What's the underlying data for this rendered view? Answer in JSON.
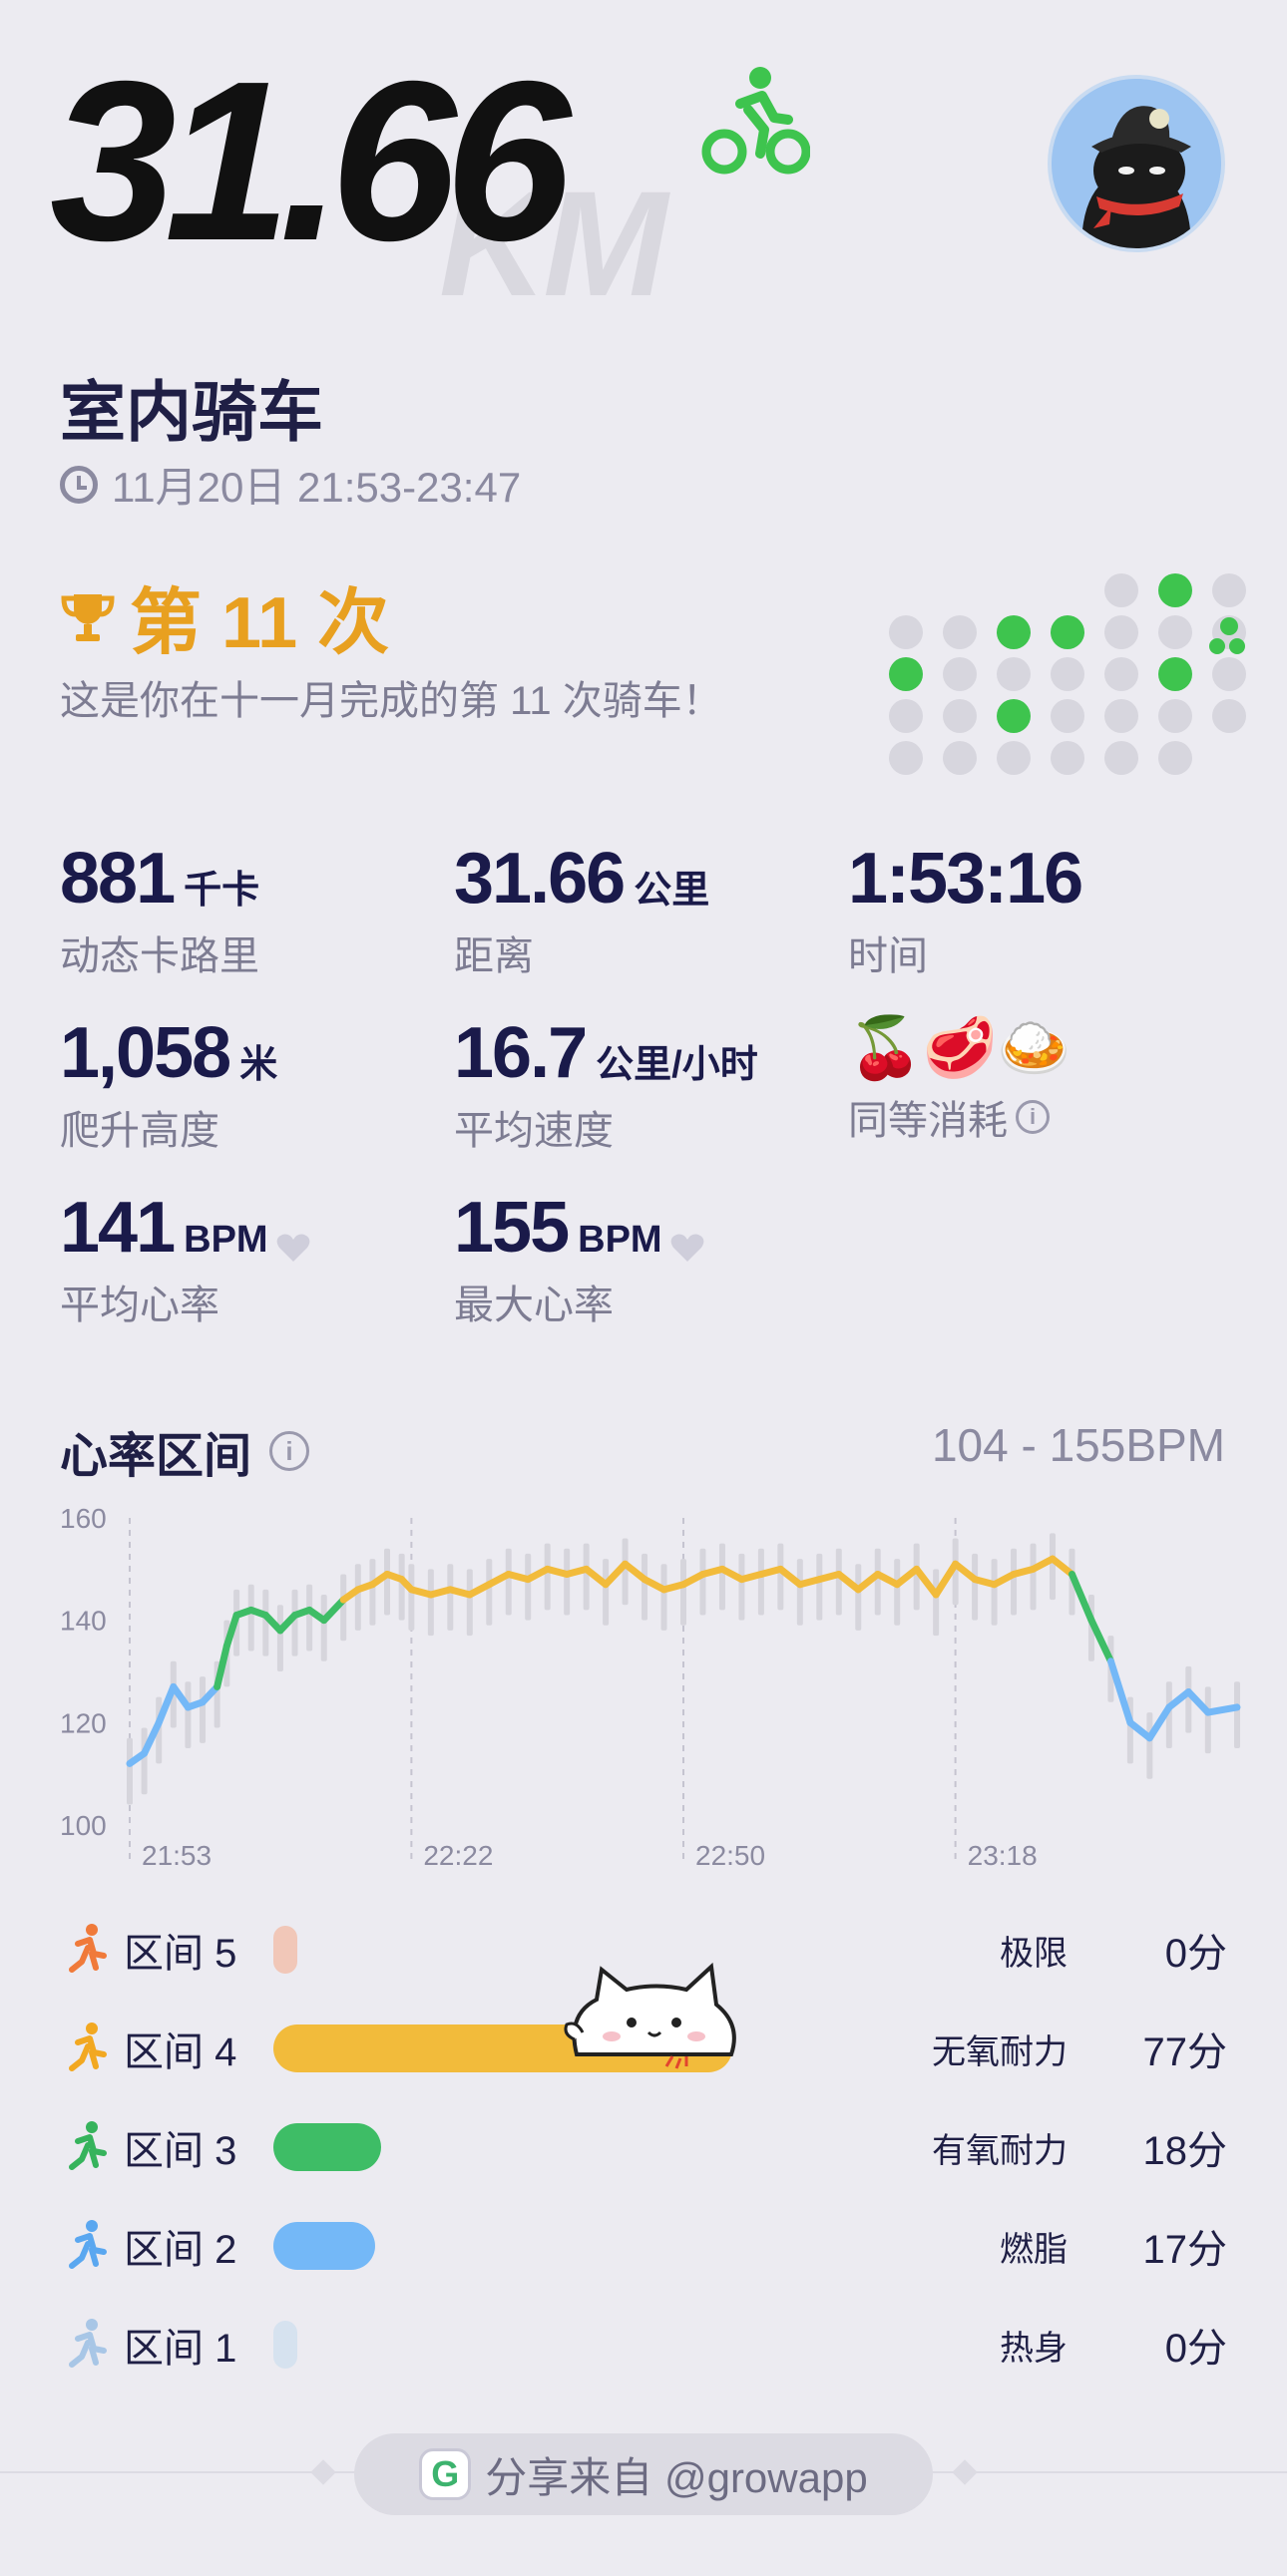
{
  "header": {
    "distance": "31.66",
    "distance_unit_bg": "KM",
    "activity_icon": "bike-icon",
    "avatar_icon": "cat-avatar-icon"
  },
  "activity": {
    "title": "室内骑车",
    "datetime": "11月20日 21:53-23:47"
  },
  "achievement": {
    "count_label": "第 11 次",
    "description": "这是你在十一月完成的第 11 次骑车！"
  },
  "stats": [
    {
      "value": "881",
      "unit": "千卡",
      "label": "动态卡路里"
    },
    {
      "value": "31.66",
      "unit": "公里",
      "label": "距离"
    },
    {
      "value": "1:53:16",
      "unit": "",
      "label": "时间"
    },
    {
      "value": "1,058",
      "unit": "米",
      "label": "爬升高度"
    },
    {
      "value": "16.7",
      "unit": "公里/小时",
      "label": "平均速度"
    },
    {
      "value": "🍒🥩🍛",
      "unit": "",
      "label": "同等消耗"
    },
    {
      "value": "141",
      "unit": "BPM",
      "label": "平均心率"
    },
    {
      "value": "155",
      "unit": "BPM",
      "label": "最大心率"
    }
  ],
  "heart_rate": {
    "title": "心率区间",
    "range": "104 - 155BPM"
  },
  "chart_data": {
    "type": "line",
    "title": "",
    "xlabel": "",
    "ylabel": "",
    "ylim": [
      100,
      160
    ],
    "y_ticks": [
      "160",
      "140",
      "120",
      "100"
    ],
    "x_ticks": [
      "21:53",
      "22:22",
      "22:50",
      "23:18"
    ],
    "x_minutes_ticks": [
      0,
      29,
      57,
      85
    ],
    "x_range_minutes": [
      0,
      114
    ],
    "series": [
      {
        "x": [
          0,
          1.5,
          3,
          4.5,
          6,
          7.5,
          9,
          10,
          11,
          12.5,
          14,
          15.5,
          17,
          18.5,
          20,
          22,
          23.5,
          25,
          26.5,
          28,
          29,
          31,
          33,
          35,
          37,
          39,
          41,
          43,
          45,
          47,
          49,
          51,
          53,
          55,
          57,
          59,
          61,
          63,
          65,
          67,
          69,
          71,
          73,
          75,
          77,
          79,
          81,
          83,
          85,
          87,
          89,
          91,
          93,
          95,
          97,
          99,
          101,
          103,
          105,
          107,
          109,
          111,
          114
        ],
        "y": [
          112,
          114,
          120,
          127,
          123,
          124,
          127,
          135,
          141,
          142,
          141,
          138,
          141,
          142,
          140,
          144,
          146,
          147,
          149,
          148,
          146,
          145,
          146,
          145,
          147,
          149,
          148,
          150,
          149,
          150,
          147,
          151,
          148,
          146,
          147,
          149,
          150,
          148,
          149,
          150,
          147,
          148,
          149,
          146,
          149,
          147,
          150,
          145,
          151,
          148,
          147,
          149,
          150,
          152,
          149,
          140,
          132,
          120,
          117,
          123,
          126,
          122,
          123
        ]
      }
    ],
    "zone_colors": {
      "zone1": "#d6e2ef",
      "zone2": "#74b8f7",
      "zone3": "#3ebd66",
      "zone4": "#f2bb3b",
      "zone5": "#f1c7b8"
    }
  },
  "zones": [
    {
      "label": "区间 5",
      "name": "极限",
      "minutes": "0分",
      "value": 0,
      "icon": "sprint-icon",
      "color": "#f1c7b8",
      "icon_color": "#f07a3a"
    },
    {
      "label": "区间 4",
      "name": "无氧耐力",
      "minutes": "77分",
      "value": 77,
      "icon": "run-icon",
      "color": "#f2bb3b",
      "icon_color": "#f2a821"
    },
    {
      "label": "区间 3",
      "name": "有氧耐力",
      "minutes": "18分",
      "value": 18,
      "icon": "jog-icon",
      "color": "#3ebd66",
      "icon_color": "#36b35c"
    },
    {
      "label": "区间 2",
      "name": "燃脂",
      "minutes": "17分",
      "value": 17,
      "icon": "walk-icon",
      "color": "#74b8f7",
      "icon_color": "#5aa7f0"
    },
    {
      "label": "区间 1",
      "name": "热身",
      "minutes": "0分",
      "value": 0,
      "icon": "stretch-icon",
      "color": "#d6e2ef",
      "icon_color": "#a8c6e6"
    }
  ],
  "footer": {
    "share_text": "分享来自 @growapp",
    "logo_letter": "G"
  },
  "colors": {
    "accent_green": "#3ec44e",
    "gold": "#e8a020",
    "dot_gray": "#d7d6de"
  }
}
